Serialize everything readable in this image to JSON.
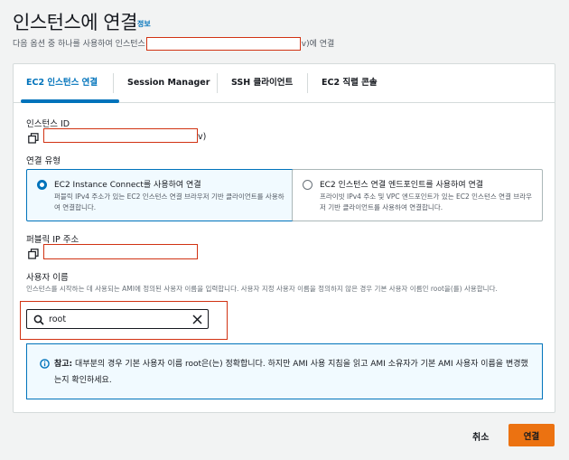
{
  "header": {
    "title": "인스턴스에 연결",
    "info_link": "정보",
    "subtitle_prefix": "다음 옵션 중 하나를 사용하여 인스턴스",
    "subtitle_suffix": "v)에 연결"
  },
  "tabs": [
    {
      "label": "EC2 인스턴스 연결",
      "active": true
    },
    {
      "label": "Session Manager",
      "active": false
    },
    {
      "label": "SSH 클라이언트",
      "active": false
    },
    {
      "label": "EC2 직렬 콘솔",
      "active": false
    }
  ],
  "instance_id": {
    "label": "인스턴스 ID",
    "value_suffix": "v)"
  },
  "connection_type": {
    "label": "연결 유형",
    "options": [
      {
        "title": "EC2 Instance Connect를 사용하여 연결",
        "description": "퍼블릭 IPv4 주소가 있는 EC2 인스턴스 연결 브라우저 기반 클라이언트를 사용하여 연결합니다.",
        "selected": true
      },
      {
        "title": "EC2 인스턴스 연결 엔드포인트를 사용하여 연결",
        "description": "프라이빗 IPv4 주소 및 VPC 엔드포인트가 있는 EC2 인스턴스 연결 브라우저 기반 클라이언트를 사용하여 연결합니다.",
        "selected": false
      }
    ]
  },
  "public_ip": {
    "label": "퍼블릭 IP 주소"
  },
  "username": {
    "label": "사용자 이름",
    "hint": "인스턴스를 시작하는 데 사용되는 AMI에 정의된 사용자 이름을 입력합니다. 사용자 지정 사용자 이름을 정의하지 않은 경우 기본 사용자 이름인 root을(를) 사용합니다.",
    "value": "root"
  },
  "alert": {
    "bold": "참고:",
    "text": " 대부분의 경우 기본 사용자 이름 root은(는) 정확합니다. 하지만 AMI 사용 지침을 읽고 AMI 소유자가 기본 AMI 사용자 이름을 변경했는지 확인하세요."
  },
  "footer": {
    "cancel": "취소",
    "connect": "연결"
  },
  "colors": {
    "accent": "#0073bb",
    "primary_button": "#ec7211",
    "redaction": "#d13212"
  },
  "icons": [
    "copy-icon",
    "search-icon",
    "close-icon",
    "info-icon"
  ]
}
